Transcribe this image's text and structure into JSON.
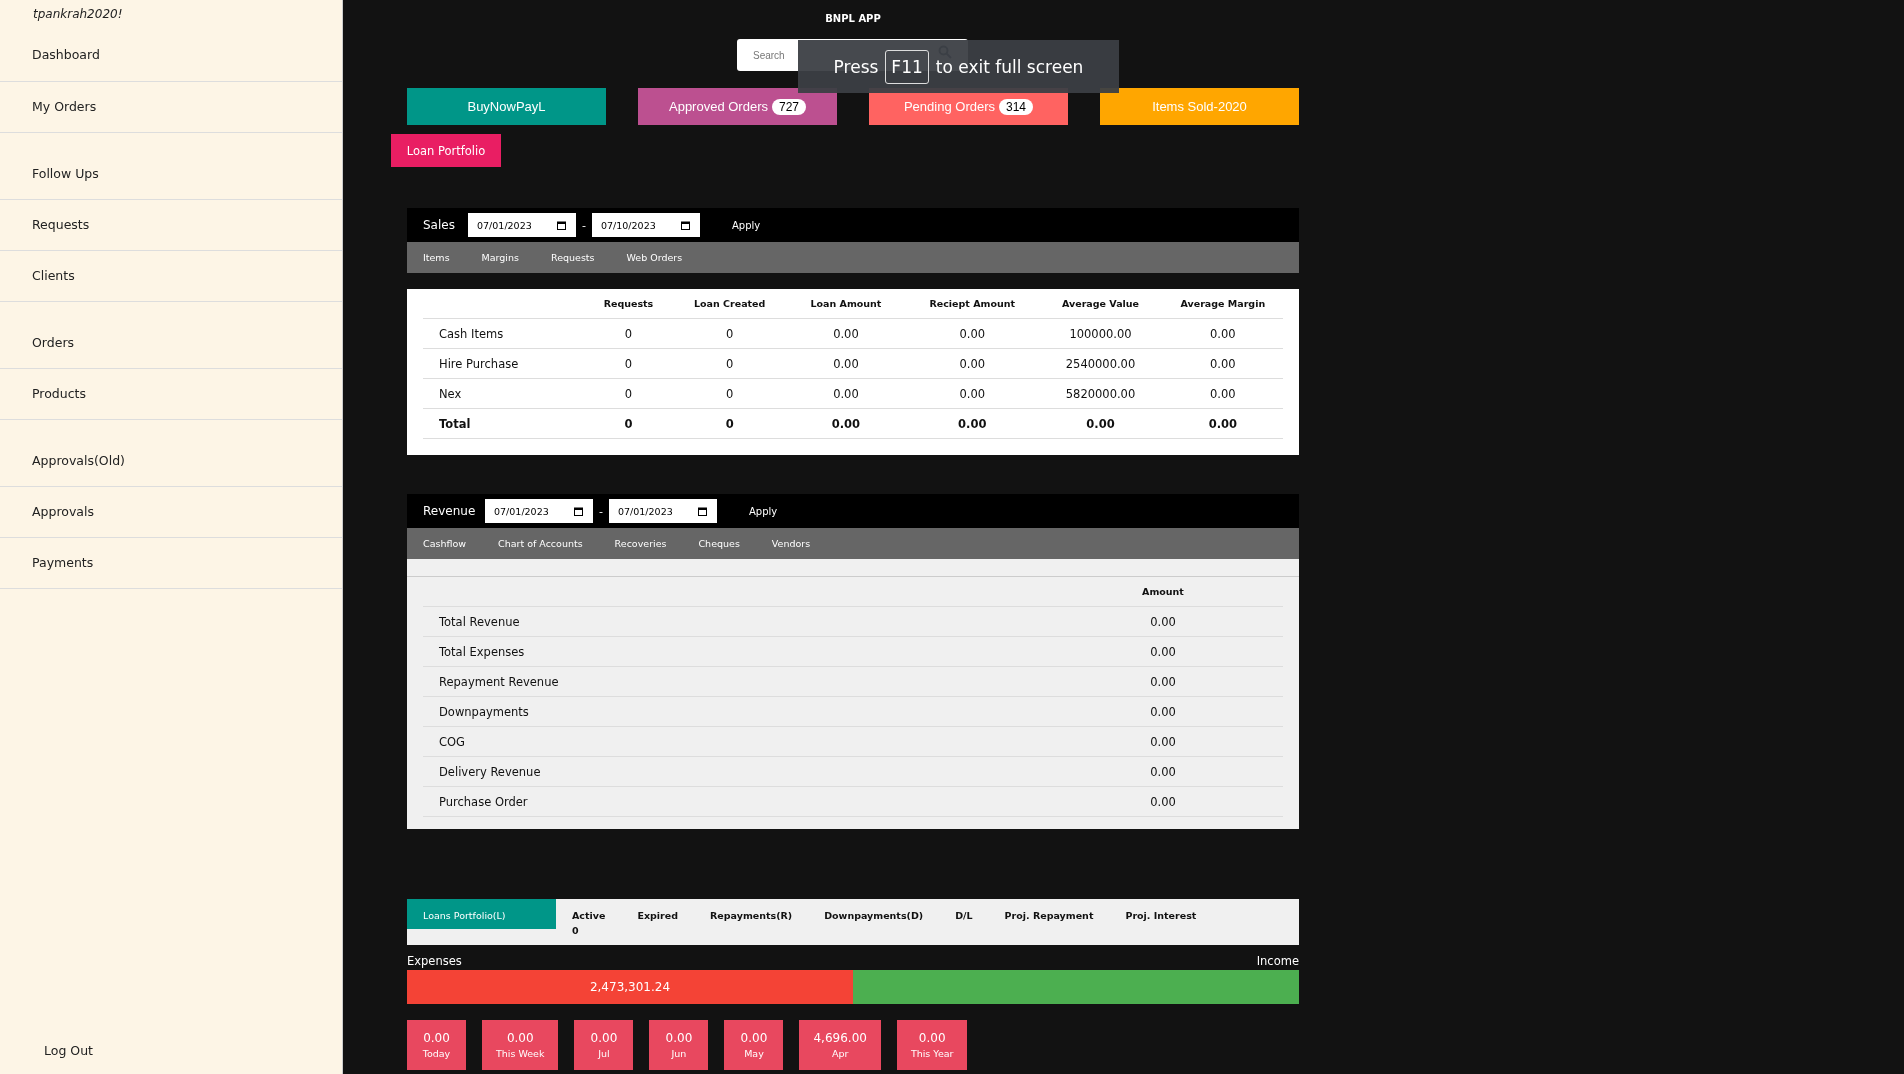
{
  "sidebar": {
    "user": "tpankrah2020!",
    "groups": [
      {
        "items": [
          {
            "label": "Dashboard"
          },
          {
            "label": "My Orders"
          }
        ]
      },
      {
        "items": [
          {
            "label": "Follow Ups"
          },
          {
            "label": "Requests"
          },
          {
            "label": "Clients"
          }
        ]
      },
      {
        "items": [
          {
            "label": "Orders"
          },
          {
            "label": "Products"
          }
        ]
      },
      {
        "items": [
          {
            "label": "Approvals(Old)"
          },
          {
            "label": "Approvals"
          },
          {
            "label": "Payments"
          }
        ]
      }
    ],
    "logout": "Log Out"
  },
  "header": {
    "title": "BNPL APP",
    "search": {
      "placeholder": "Search"
    }
  },
  "fullscreen_notice": {
    "before": "Press",
    "key": "F11",
    "after": "to exit full screen"
  },
  "quick_buttons": [
    {
      "label": "BuyNowPayL",
      "color": "#009688"
    },
    {
      "label": "Approved Orders",
      "badge": "727",
      "color": "#bc5090"
    },
    {
      "label": "Pending Orders",
      "badge": "314",
      "color": "#ff6361"
    },
    {
      "label": "Items Sold-2020",
      "color": "#ffa600"
    }
  ],
  "loan_portfolio_button": "Loan Portfolio",
  "sales": {
    "title": "Sales",
    "from": "07/01/2023",
    "to": "07/10/2023",
    "separator": "-",
    "apply": "Apply",
    "tabs": [
      "Items",
      "Margins",
      "Requests",
      "Web Orders"
    ],
    "columns": [
      "Requests",
      "Loan Created",
      "Loan Amount",
      "Reciept Amount",
      "Average Value",
      "Average Margin"
    ],
    "rows": [
      {
        "kind": "item",
        "label": "Cash Items",
        "values": [
          "0",
          "0",
          "0.00",
          "0.00",
          "100000.00",
          "0.00"
        ]
      },
      {
        "kind": "item",
        "label": "Hire Purchase",
        "values": [
          "0",
          "0",
          "0.00",
          "0.00",
          "2540000.00",
          "0.00"
        ]
      },
      {
        "kind": "item",
        "label": "Nex",
        "values": [
          "0",
          "0",
          "0.00",
          "0.00",
          "5820000.00",
          "0.00"
        ]
      },
      {
        "kind": "total",
        "label": "Total",
        "values": [
          "0",
          "0",
          "0.00",
          "0.00",
          "0.00",
          "0.00"
        ]
      }
    ]
  },
  "revenue": {
    "title": "Revenue",
    "from": "07/01/2023",
    "to": "07/01/2023",
    "separator": "-",
    "apply": "Apply",
    "tabs": [
      "Cashflow",
      "Chart of Accounts",
      "Recoveries",
      "Cheques",
      "Vendors"
    ],
    "column": "Amount",
    "rows": [
      {
        "label": "Total Revenue",
        "amount": "0.00"
      },
      {
        "label": "Total Expenses",
        "amount": "0.00"
      },
      {
        "label": "Repayment Revenue",
        "amount": "0.00"
      },
      {
        "label": "Downpayments",
        "amount": "0.00"
      },
      {
        "label": "COG",
        "amount": "0.00"
      },
      {
        "label": "Delivery Revenue",
        "amount": "0.00"
      },
      {
        "label": "Purchase Order",
        "amount": "0.00"
      }
    ]
  },
  "loans": {
    "tabs": [
      {
        "label": "Loans Portfolio(L)",
        "selected": true
      },
      {
        "label": "Active",
        "count": "0",
        "selected": false
      },
      {
        "label": "Expired",
        "selected": false
      },
      {
        "label": "Repayments(R)",
        "selected": false
      },
      {
        "label": "Downpayments(D)",
        "selected": false
      },
      {
        "label": "D/L",
        "selected": false
      },
      {
        "label": "Proj. Repayment",
        "selected": false
      },
      {
        "label": "Proj. Interest",
        "selected": false
      }
    ],
    "expenses_label": "Expenses",
    "income_label": "Income",
    "expenses_value": "2,473,301.24",
    "level": 0.5,
    "tiles": [
      {
        "value": "0.00",
        "label": "Today"
      },
      {
        "value": "0.00",
        "label": "This Week"
      },
      {
        "value": "0.00",
        "label": "Jul"
      },
      {
        "value": "0.00",
        "label": "Jun"
      },
      {
        "value": "0.00",
        "label": "May"
      },
      {
        "value": "4,696.00",
        "label": "Apr"
      },
      {
        "value": "0.00",
        "label": "This Year"
      }
    ]
  }
}
